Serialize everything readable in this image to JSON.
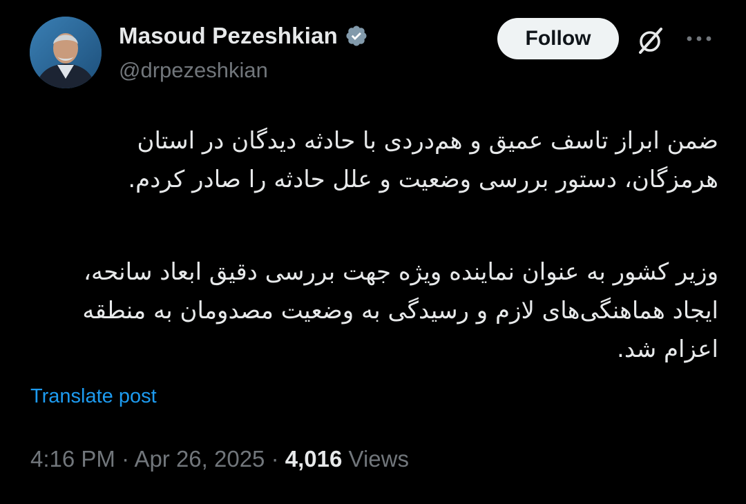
{
  "author": {
    "display_name": "Masoud Pezeshkian",
    "handle": "@drpezeshkian",
    "verified": true,
    "avatar_icon": "profile-photo"
  },
  "actions": {
    "follow_label": "Follow",
    "grok_icon": "grok-icon",
    "more_icon": "more-icon"
  },
  "tweet": {
    "paragraphs": [
      "ضمن ابراز تاسف عمیق و هم‌دردی با حادثه دیدگان در استان هرمزگان، دستور بررسی وضعیت و علل حادثه را صادر کردم.",
      "وزیر کشور به عنوان نماینده ویژه جهت بررسی دقیق ابعاد سانحه، ایجاد هماهنگی‌های لازم و رسیدگی به وضعیت مصدومان به منطقه اعزام شد."
    ],
    "translate_label": "Translate post"
  },
  "meta": {
    "time": "4:16 PM",
    "separator": "·",
    "date": "Apr 26, 2025",
    "views_count": "4,016",
    "views_label": "Views"
  },
  "colors": {
    "background": "#000000",
    "text_primary": "#e7e9ea",
    "text_secondary": "#71767b",
    "link": "#1d9bf0",
    "verified_badge": "#829aab",
    "follow_bg": "#eff3f4"
  }
}
